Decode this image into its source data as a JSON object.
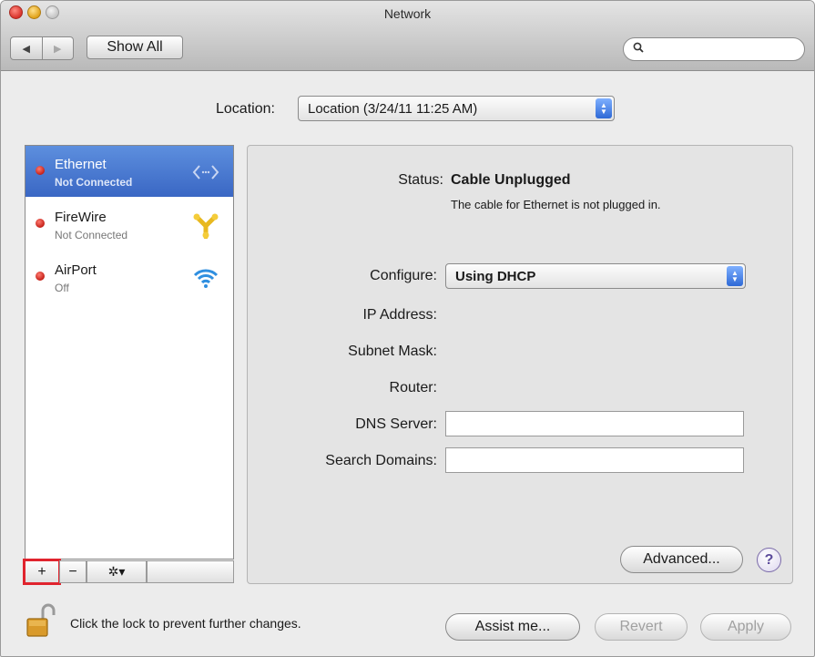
{
  "window": {
    "title": "Network"
  },
  "toolbar": {
    "back_label": "◀",
    "forward_label": "▶",
    "show_all_label": "Show All",
    "search_placeholder": ""
  },
  "location": {
    "label": "Location:",
    "selected": "Location (3/24/11 11:25 AM)"
  },
  "services": [
    {
      "name": "Ethernet",
      "status": "Not Connected",
      "selected": true,
      "icon": "ethernet-icon"
    },
    {
      "name": "FireWire",
      "status": "Not Connected",
      "selected": false,
      "icon": "firewire-icon"
    },
    {
      "name": "AirPort",
      "status": "Off",
      "selected": false,
      "icon": "wifi-icon"
    }
  ],
  "service_tools": {
    "add_label": "+",
    "remove_label": "−",
    "action_label": "✲▾"
  },
  "detail": {
    "status_label": "Status:",
    "status_value": "Cable Unplugged",
    "status_description": "The cable for Ethernet is not plugged in.",
    "configure_label": "Configure:",
    "configure_value": "Using DHCP",
    "ip_label": "IP Address:",
    "subnet_label": "Subnet Mask:",
    "router_label": "Router:",
    "dns_label": "DNS Server:",
    "dns_value": "",
    "search_domains_label": "Search Domains:",
    "search_domains_value": "",
    "advanced_label": "Advanced...",
    "help_label": "?"
  },
  "footer": {
    "lock_text": "Click the lock to prevent further changes.",
    "assist_label": "Assist me...",
    "revert_label": "Revert",
    "apply_label": "Apply"
  },
  "colors": {
    "selection": "#3a67c4",
    "status_dot": "#c42018",
    "highlight_box": "#e0242e",
    "popup_arrows": "#2e69d6"
  }
}
